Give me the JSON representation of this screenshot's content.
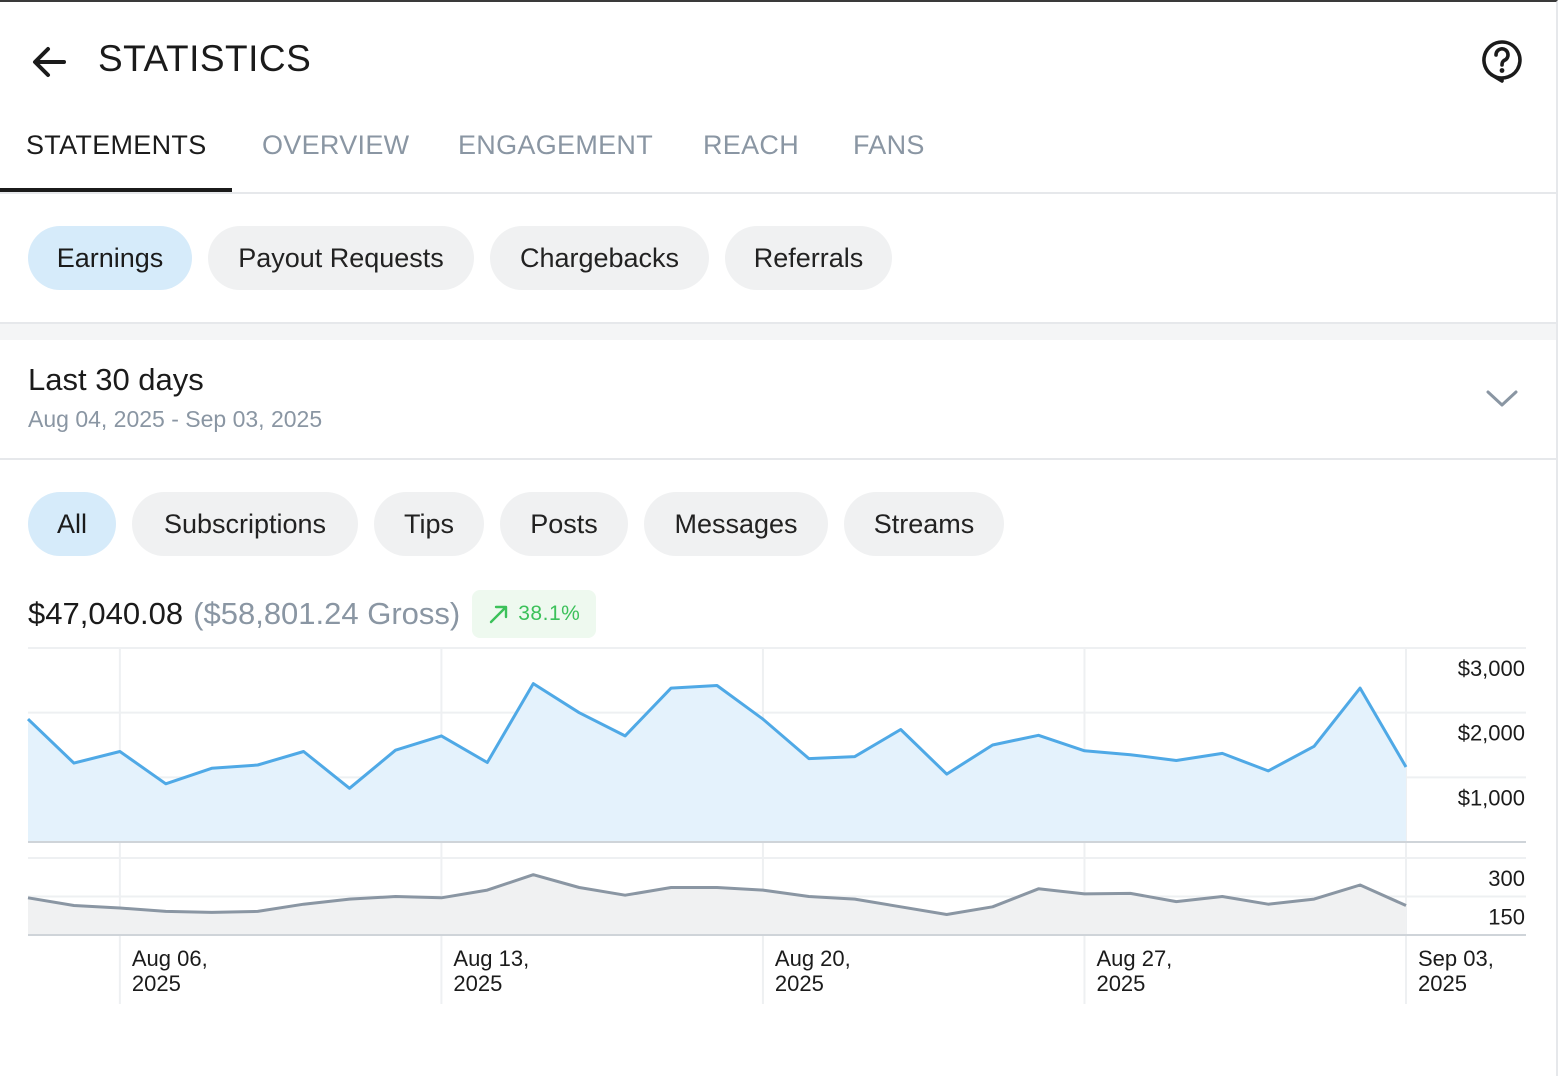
{
  "header": {
    "title": "STATISTICS",
    "back_icon": "arrow-left-icon",
    "help_icon": "help-circle-icon"
  },
  "tabs": [
    {
      "label": "STATEMENTS",
      "active": true
    },
    {
      "label": "OVERVIEW",
      "active": false
    },
    {
      "label": "ENGAGEMENT",
      "active": false
    },
    {
      "label": "REACH",
      "active": false
    },
    {
      "label": "FANS",
      "active": false
    }
  ],
  "statement_types": [
    {
      "label": "Earnings",
      "active": true
    },
    {
      "label": "Payout Requests",
      "active": false
    },
    {
      "label": "Chargebacks",
      "active": false
    },
    {
      "label": "Referrals",
      "active": false
    }
  ],
  "date_range": {
    "title": "Last 30 days",
    "subtitle": "Aug 04, 2025 - Sep 03, 2025"
  },
  "filters": [
    {
      "label": "All",
      "active": true
    },
    {
      "label": "Subscriptions",
      "active": false
    },
    {
      "label": "Tips",
      "active": false
    },
    {
      "label": "Posts",
      "active": false
    },
    {
      "label": "Messages",
      "active": false
    },
    {
      "label": "Streams",
      "active": false
    }
  ],
  "summary": {
    "net": "$47,040.08",
    "gross": "($58,801.24 Gross)",
    "change": "38.1%"
  },
  "colors": {
    "accent": "#4fa9e6",
    "accent_fill": "#e4f2fc",
    "secondary_line": "#8a96a3",
    "positive": "#3cc15a"
  },
  "chart_data": [
    {
      "type": "area",
      "x": [
        "2025-08-04",
        "2025-08-05",
        "2025-08-06",
        "2025-08-07",
        "2025-08-08",
        "2025-08-09",
        "2025-08-10",
        "2025-08-11",
        "2025-08-12",
        "2025-08-13",
        "2025-08-14",
        "2025-08-15",
        "2025-08-16",
        "2025-08-17",
        "2025-08-18",
        "2025-08-19",
        "2025-08-20",
        "2025-08-21",
        "2025-08-22",
        "2025-08-23",
        "2025-08-24",
        "2025-08-25",
        "2025-08-26",
        "2025-08-27",
        "2025-08-28",
        "2025-08-29",
        "2025-08-30",
        "2025-08-31",
        "2025-09-01",
        "2025-09-02",
        "2025-09-03"
      ],
      "values": [
        1900,
        1220,
        1400,
        900,
        1140,
        1190,
        1400,
        830,
        1420,
        1640,
        1230,
        2450,
        2000,
        1640,
        2380,
        2420,
        1900,
        1290,
        1320,
        1740,
        1050,
        1500,
        1650,
        1410,
        1350,
        1260,
        1370,
        1100,
        1480,
        2380,
        1160
      ],
      "yticks": [
        "$1,000",
        "$2,000",
        "$3,000"
      ],
      "ylim": [
        0,
        3000
      ],
      "grid": true
    },
    {
      "type": "area",
      "x": [
        "2025-08-04",
        "2025-08-05",
        "2025-08-06",
        "2025-08-07",
        "2025-08-08",
        "2025-08-09",
        "2025-08-10",
        "2025-08-11",
        "2025-08-12",
        "2025-08-13",
        "2025-08-14",
        "2025-08-15",
        "2025-08-16",
        "2025-08-17",
        "2025-08-18",
        "2025-08-19",
        "2025-08-20",
        "2025-08-21",
        "2025-08-22",
        "2025-08-23",
        "2025-08-24",
        "2025-08-25",
        "2025-08-26",
        "2025-08-27",
        "2025-08-28",
        "2025-08-29",
        "2025-08-30",
        "2025-08-31",
        "2025-09-01",
        "2025-09-02",
        "2025-09-03"
      ],
      "values": [
        145,
        115,
        105,
        92,
        88,
        92,
        120,
        140,
        150,
        145,
        175,
        235,
        185,
        155,
        185,
        185,
        175,
        150,
        140,
        110,
        80,
        110,
        180,
        160,
        162,
        130,
        150,
        120,
        140,
        195,
        115
      ],
      "yticks": [
        "150",
        "300"
      ],
      "xticks": [
        "Aug 06,\n2025",
        "Aug 13,\n2025",
        "Aug 20,\n2025",
        "Aug 27,\n2025",
        "Sep 03,\n2025"
      ],
      "grid": true
    }
  ]
}
